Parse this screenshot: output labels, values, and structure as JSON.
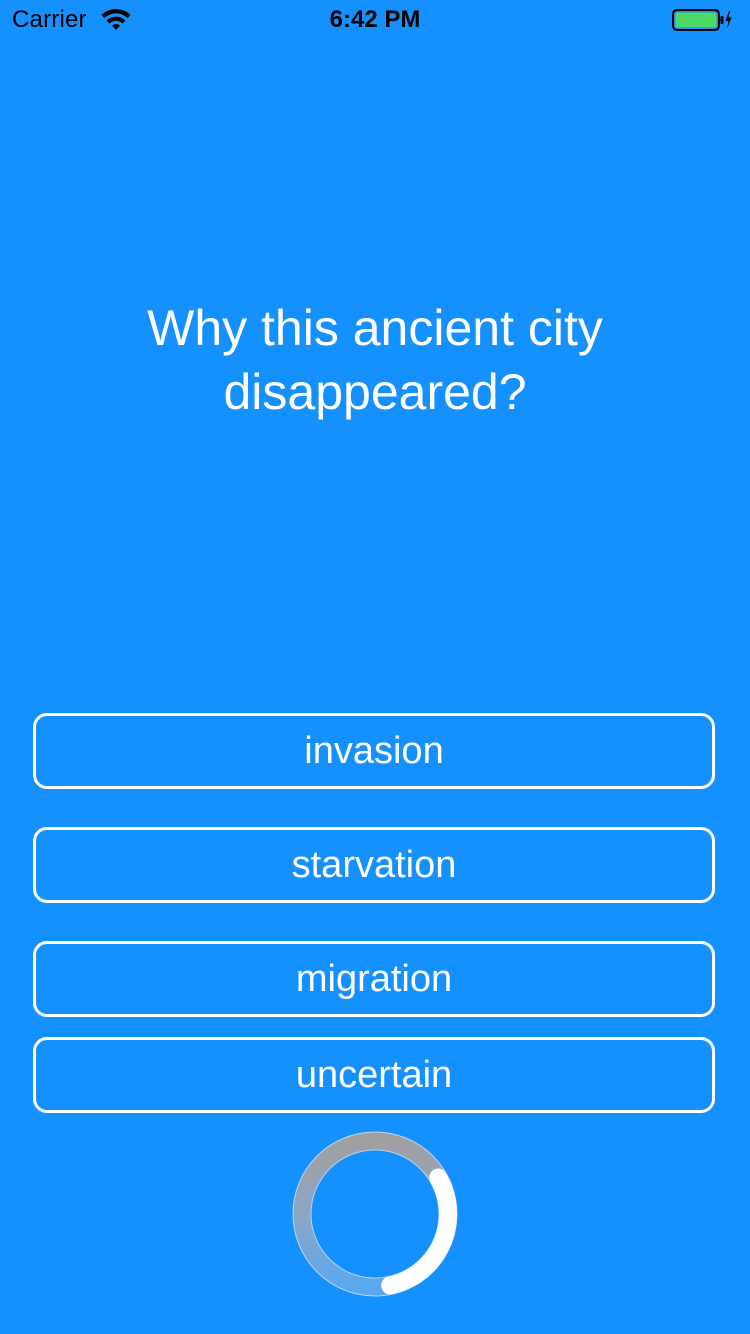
{
  "status_bar": {
    "carrier": "Carrier",
    "time": "6:42 PM",
    "icons": [
      "wifi-icon",
      "battery-icon",
      "charging-bolt-icon"
    ],
    "battery_color": "#4CD964"
  },
  "quiz": {
    "question": "Why this ancient city disappeared?",
    "answers": [
      {
        "label": "invasion"
      },
      {
        "label": "starvation"
      },
      {
        "label": "migration"
      },
      {
        "label": "uncertain"
      }
    ]
  },
  "timer": {
    "progress": 0.3,
    "track_color": "#9E9E9E",
    "fill_color": "#FFFFFF"
  },
  "colors": {
    "background": "#1590FF",
    "text": "#FFFFFF",
    "button_border": "#FFFFFF"
  }
}
